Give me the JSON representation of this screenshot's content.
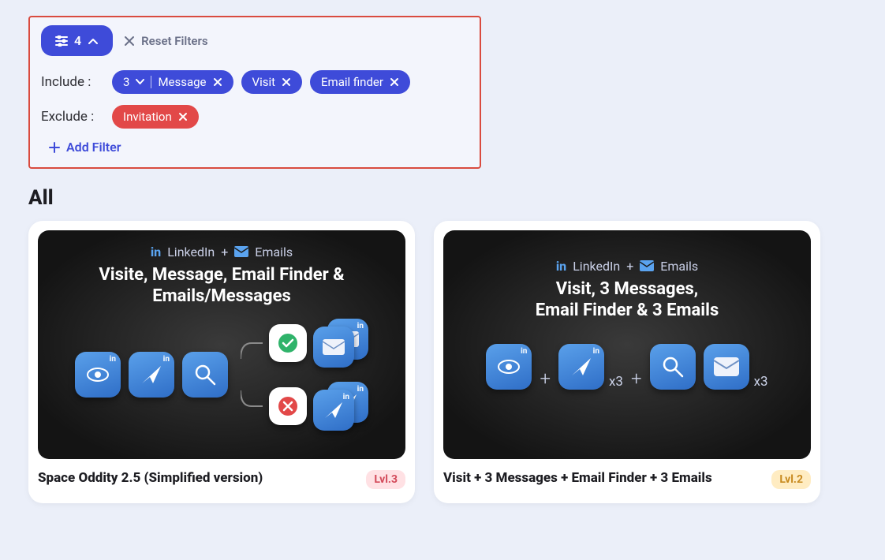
{
  "filters": {
    "count": "4",
    "reset_label": "Reset Filters",
    "include_label": "Include :",
    "exclude_label": "Exclude :",
    "include_primary": {
      "count": "3",
      "label": "Message"
    },
    "include_chips": [
      {
        "label": "Visit"
      },
      {
        "label": "Email finder"
      }
    ],
    "exclude_chips": [
      {
        "label": "Invitation"
      }
    ],
    "add_filter_label": "Add Filter"
  },
  "section_heading": "All",
  "channels": {
    "linkedin": "LinkedIn",
    "plus": "+",
    "emails": "Emails"
  },
  "cards": [
    {
      "visual_title_line1": "Visite, Message, Email Finder &",
      "visual_title_line2": "Emails/Messages",
      "title": "Space Oddity 2.5 (Simplified version)",
      "level": "Lvl.3"
    },
    {
      "visual_title_line1": "Visit, 3 Messages,",
      "visual_title_line2": "Email Finder & 3 Emails",
      "x3_label_a": "x3",
      "x3_label_b": "x3",
      "title": "Visit + 3 Messages + Email Finder + 3 Emails",
      "level": "Lvl.2"
    }
  ]
}
